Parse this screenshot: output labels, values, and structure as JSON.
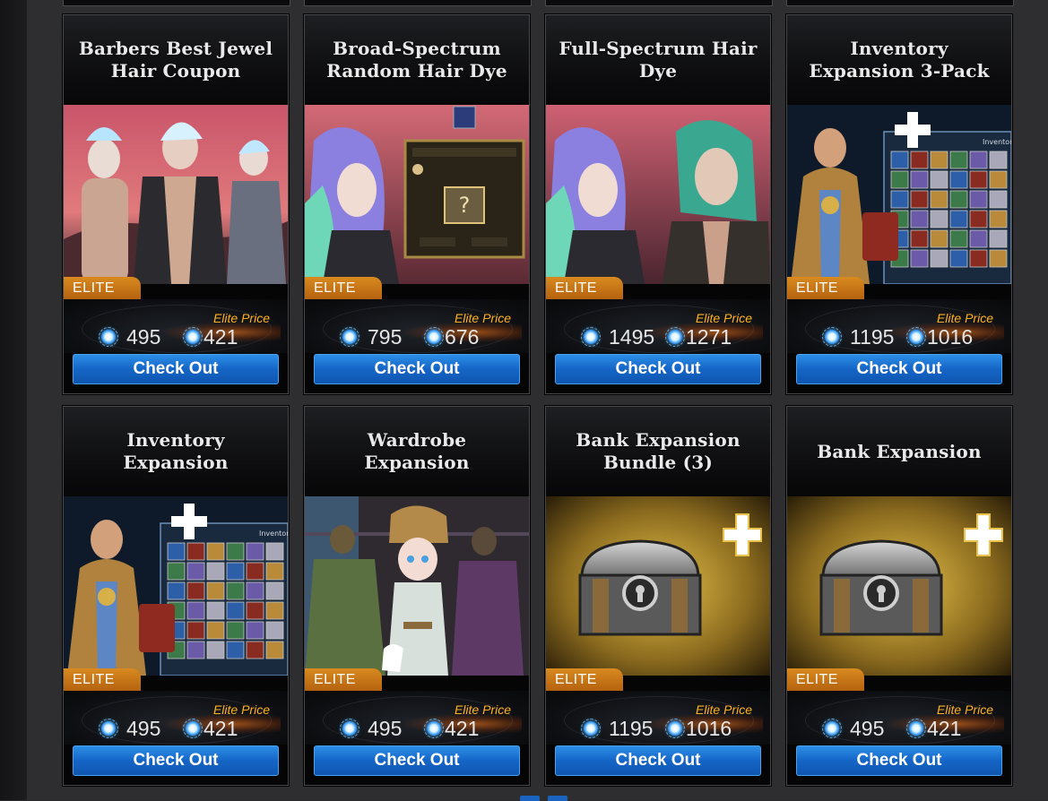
{
  "products": [
    {
      "title": "Barbers Best Jewel Hair Coupon",
      "badge": "ELITE",
      "elite_label": "Elite Price",
      "price": "495",
      "elite_price": "421",
      "button": "Check Out",
      "image": "characters"
    },
    {
      "title": "Broad-Spectrum Random Hair Dye",
      "badge": "ELITE",
      "elite_label": "Elite Price",
      "price": "795",
      "elite_price": "676",
      "button": "Check Out",
      "image": "dye-box"
    },
    {
      "title": "Full-Spectrum Hair Dye",
      "badge": "ELITE",
      "elite_label": "Elite Price",
      "price": "1495",
      "elite_price": "1271",
      "button": "Check Out",
      "image": "two-characters"
    },
    {
      "title": "Inventory Expansion 3-Pack",
      "badge": "ELITE",
      "elite_label": "Elite Price",
      "price": "1195",
      "elite_price": "1016",
      "button": "Check Out",
      "image": "inventory"
    },
    {
      "title": "Inventory Expansion",
      "badge": "ELITE",
      "elite_label": "Elite Price",
      "price": "495",
      "elite_price": "421",
      "button": "Check Out",
      "image": "inventory"
    },
    {
      "title": "Wardrobe Expansion",
      "badge": "ELITE",
      "elite_label": "Elite Price",
      "price": "495",
      "elite_price": "421",
      "button": "Check Out",
      "image": "wardrobe"
    },
    {
      "title": "Bank Expansion Bundle (3)",
      "badge": "ELITE",
      "elite_label": "Elite Price",
      "price": "1195",
      "elite_price": "1016",
      "button": "Check Out",
      "image": "chest"
    },
    {
      "title": "Bank Expansion",
      "badge": "ELITE",
      "elite_label": "Elite Price",
      "price": "495",
      "elite_price": "421",
      "button": "Check Out",
      "image": "chest"
    }
  ],
  "currency_icon": "coin-icon",
  "colors": {
    "badge": "#c8761a",
    "elite_price_label": "#ffb01f",
    "button": "#1565c6",
    "background": "#2e2e30"
  }
}
